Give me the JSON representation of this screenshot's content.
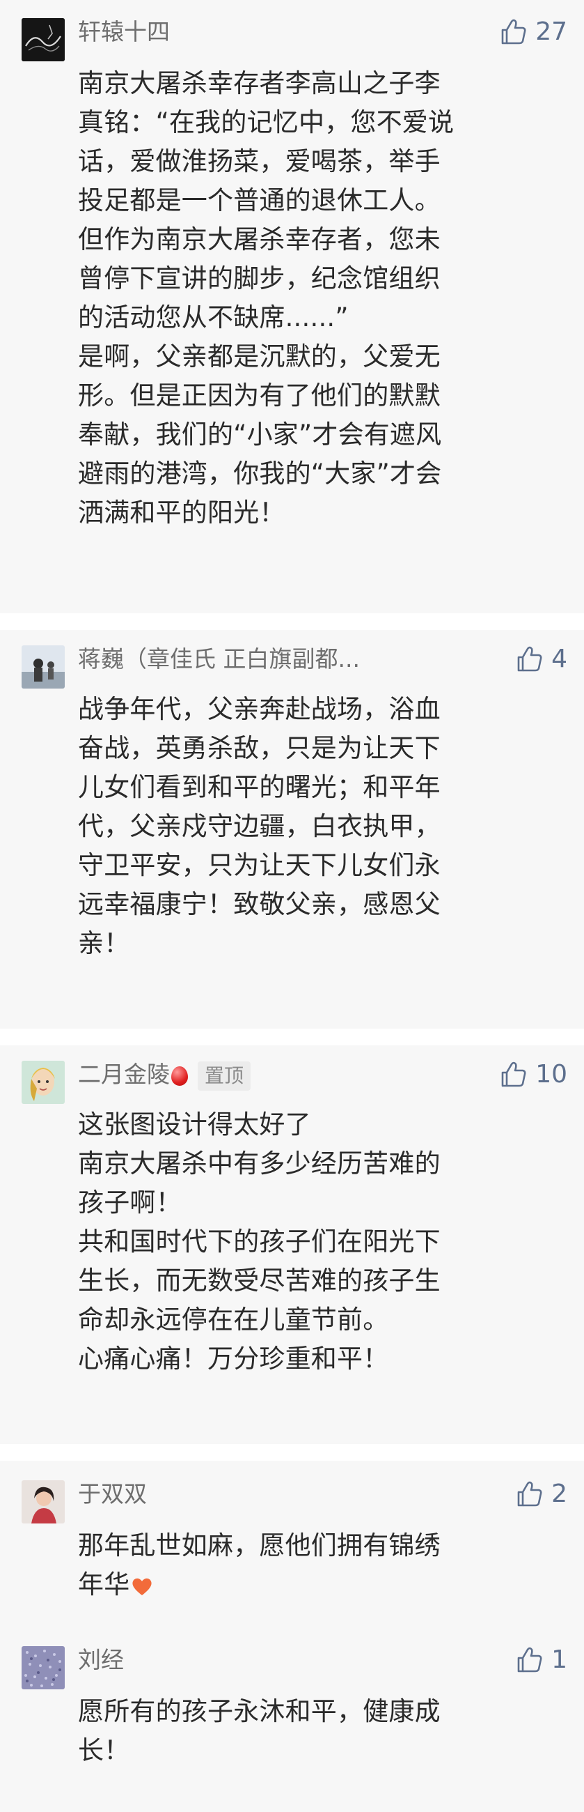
{
  "comments": [
    {
      "username": "轩辕十四",
      "likes": "27",
      "lines": [
        "南京大屠杀幸存者李高山之子李",
        "真铭：“在我的记忆中，您不爱说",
        "话，爱做淮扬菜，爱喝茶，举手",
        "投足都是一个普通的退休工人。",
        "但作为南京大屠杀幸存者，您未",
        "曾停下宣讲的脚步，纪念馆组织",
        "的活动您从不缺席......”",
        "是啊，父亲都是沉默的，父爱无",
        "形。但是正因为有了他们的默默",
        "奉献，我们的“小家”才会有遮风",
        "避雨的港湾，你我的“大家”才会",
        "洒满和平的阳光！"
      ]
    },
    {
      "username": "蒋巍（章佳氏 正白旗副都...",
      "likes": "4",
      "lines": [
        "战争年代，父亲奔赴战场，浴血",
        "奋战，英勇杀敌，只是为让天下",
        "儿女们看到和平的曙光；和平年",
        "代，父亲戍守边疆，白衣执甲，",
        "守卫平安，只为让天下儿女们永",
        "远幸福康宁！致敬父亲，感恩父",
        "亲！"
      ]
    },
    {
      "username": "二月金陵",
      "pin_label": "置顶",
      "likes": "10",
      "lines": [
        "这张图设计得太好了",
        "南京大屠杀中有多少经历苦难的",
        "孩子啊！",
        "共和国时代下的孩子们在阳光下",
        "生长，而无数受尽苦难的孩子生",
        "命却永远停在在儿童节前。",
        "心痛心痛！万分珍重和平！"
      ]
    },
    {
      "username": "于双双",
      "likes": "2",
      "lines": [
        "那年乱世如麻，愿他们拥有锦绣",
        "年华"
      ]
    },
    {
      "username": "刘经",
      "likes": "1",
      "lines": [
        "愿所有的孩子永沐和平，健康成",
        "长！"
      ]
    }
  ],
  "colors": {
    "card_bg": "#f7f7f7",
    "username": "#6e6e6e",
    "like": "#5d6f8d",
    "text": "#2a2a2a"
  },
  "icons": {
    "like": "thumbs-up-icon",
    "balloon": "balloon-icon",
    "heart": "heart-icon"
  }
}
